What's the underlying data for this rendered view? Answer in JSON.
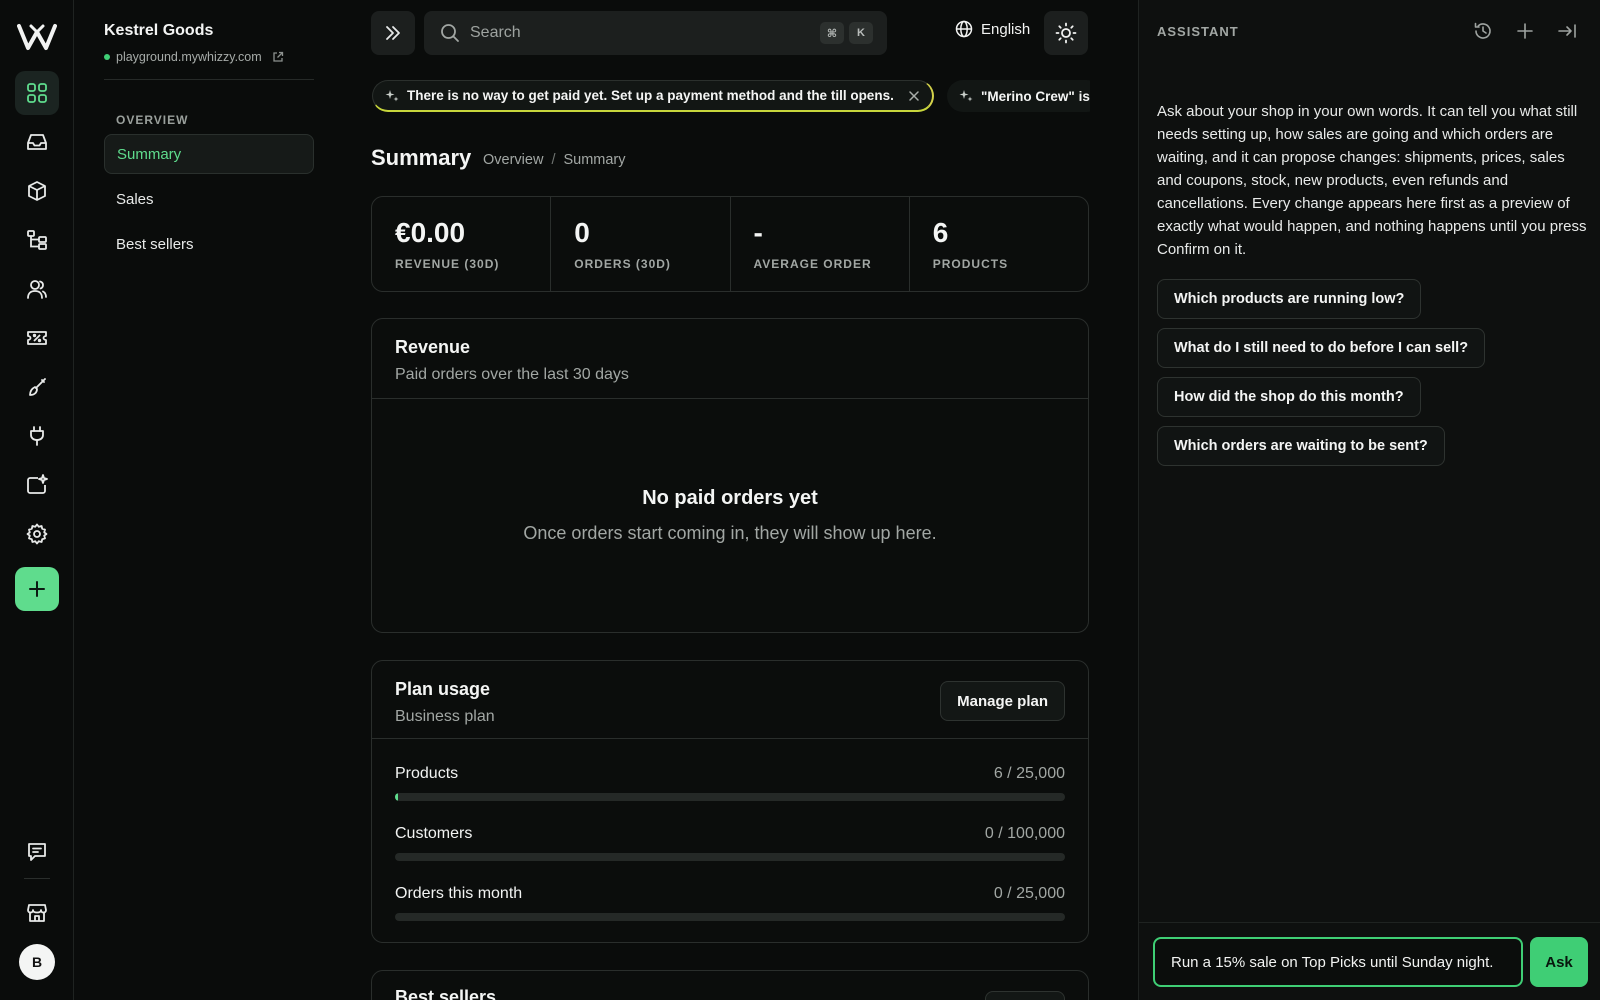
{
  "colors": {
    "accent": "#5fdc8d",
    "accent_strong": "#3fce75",
    "background": "#0a0c0b",
    "border": "#2a2e2c"
  },
  "rail": {
    "items": [
      {
        "icon": "dashboard-grid-icon",
        "active": true
      },
      {
        "icon": "inbox-icon"
      },
      {
        "icon": "box-icon"
      },
      {
        "icon": "hierarchy-icon"
      },
      {
        "icon": "customers-icon"
      },
      {
        "icon": "discount-ticket-icon"
      },
      {
        "icon": "brush-icon"
      },
      {
        "icon": "plug-icon"
      },
      {
        "icon": "ai-sparkle-icon"
      },
      {
        "icon": "gear-icon"
      },
      {
        "icon": "plus-icon"
      }
    ],
    "bottom": [
      {
        "icon": "chat-icon"
      },
      {
        "icon": "storefront-icon"
      }
    ],
    "avatar_initial": "B"
  },
  "store": {
    "name": "Kestrel Goods",
    "url": "playground.mywhizzy.com"
  },
  "sidebar": {
    "heading": "OVERVIEW",
    "items": [
      {
        "label": "Summary",
        "active": true
      },
      {
        "label": "Sales"
      },
      {
        "label": "Best sellers"
      }
    ]
  },
  "topbar": {
    "search_placeholder": "Search",
    "shortcut_keys": [
      "⌘",
      "K"
    ],
    "language": "English"
  },
  "notices": [
    {
      "text": "There is no way to get paid yet. Set up a payment method and the till opens."
    },
    {
      "text": "\"Merino Crew\" is"
    }
  ],
  "page": {
    "title": "Summary",
    "breadcrumb": [
      "Overview",
      "Summary"
    ]
  },
  "stats": [
    {
      "value": "€0.00",
      "label": "REVENUE (30D)"
    },
    {
      "value": "0",
      "label": "ORDERS (30D)"
    },
    {
      "value": "-",
      "label": "AVERAGE ORDER"
    },
    {
      "value": "6",
      "label": "PRODUCTS"
    }
  ],
  "revenue": {
    "title": "Revenue",
    "subtitle": "Paid orders over the last 30 days",
    "empty_title": "No paid orders yet",
    "empty_text": "Once orders start coming in, they will show up here."
  },
  "plan": {
    "title": "Plan usage",
    "subtitle": "Business plan",
    "manage_label": "Manage plan",
    "rows": [
      {
        "label": "Products",
        "value": "6 / 25,000",
        "used": 6,
        "limit": 25000
      },
      {
        "label": "Customers",
        "value": "0 / 100,000",
        "used": 0,
        "limit": 100000
      },
      {
        "label": "Orders this month",
        "value": "0 / 25,000",
        "used": 0,
        "limit": 25000
      }
    ]
  },
  "bestsellers": {
    "title": "Best sellers"
  },
  "assistant": {
    "title": "ASSISTANT",
    "intro": "Ask about your shop in your own words. It can tell you what still needs setting up, how sales are going and which orders are waiting, and it can propose changes: shipments, prices, sales and coupons, stock, new products, even refunds and cancellations. Every change appears here first as a preview of exactly what would happen, and nothing happens until you press Confirm on it.",
    "suggestions": [
      "Which products are running low?",
      "What do I still need to do before I can sell?",
      "How did the shop do this month?",
      "Which orders are waiting to be sent?"
    ],
    "input_value": "Run a 15% sale on Top Picks until Sunday night.",
    "ask_label": "Ask"
  }
}
